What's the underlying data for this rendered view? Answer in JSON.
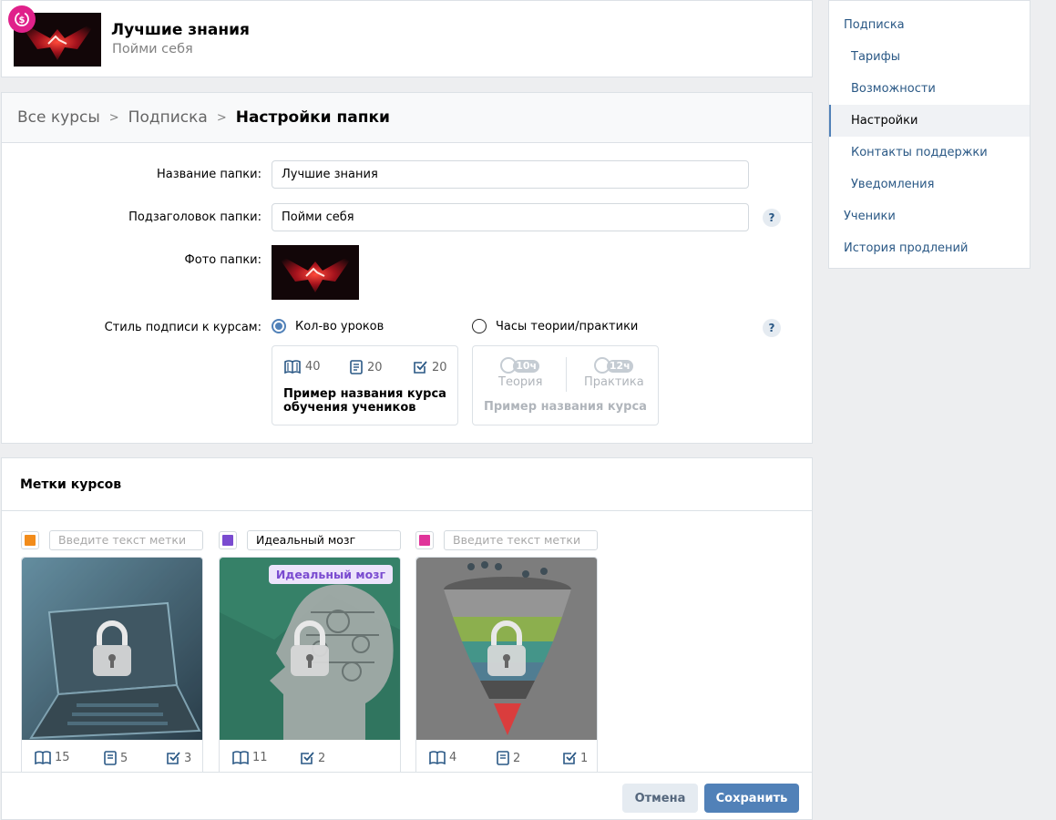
{
  "header": {
    "title": "Лучшие знания",
    "subtitle": "Пойми себя",
    "badge_icon": "subscription-dollar-icon"
  },
  "breadcrumb": {
    "items": [
      "Все курсы",
      "Подписка",
      "Настройки папки"
    ]
  },
  "form": {
    "folder_name_label": "Название папки:",
    "folder_name_value": "Лучшие знания",
    "folder_subtitle_label": "Подзаголовок папки:",
    "folder_subtitle_value": "Пойми себя",
    "folder_photo_label": "Фото папки:",
    "caption_style_label": "Стиль подписи к курсам:",
    "help_glyph": "?",
    "option_lessons": "Кол-во уроков",
    "option_hours": "Часы теории/практики",
    "selected_option": "lessons",
    "sample_lessons": {
      "lessons": "40",
      "tests": "20",
      "tasks": "20",
      "name": "Пример названия курса обучения учеников"
    },
    "sample_hours": {
      "theory_hours": "10ч",
      "theory_label": "Теория",
      "practice_hours": "12ч",
      "practice_label": "Практика",
      "name": "Пример названия курса"
    }
  },
  "tags": {
    "title": "Метки курсов",
    "items": [
      {
        "color": "#f28c1b",
        "placeholder": "Введите текст метки",
        "value": "",
        "lessons": "15",
        "tests": "5",
        "tasks": "3"
      },
      {
        "color": "#7a4bd0",
        "placeholder": "Введите текст метки",
        "value": "Идеальный мозг",
        "lessons": "11",
        "tests": "",
        "tasks": "2"
      },
      {
        "color": "#e0349a",
        "placeholder": "Введите текст метки",
        "value": "",
        "lessons": "4",
        "tests": "2",
        "tasks": "1"
      }
    ]
  },
  "buttons": {
    "cancel": "Отмена",
    "save": "Сохранить"
  },
  "sidebar": {
    "items": [
      {
        "label": "Подписка",
        "level": 0
      },
      {
        "label": "Тарифы",
        "level": 1
      },
      {
        "label": "Возможности",
        "level": 1
      },
      {
        "label": "Настройки",
        "level": 1,
        "active": true
      },
      {
        "label": "Контакты поддержки",
        "level": 1
      },
      {
        "label": "Уведомления",
        "level": 1
      },
      {
        "label": "Ученики",
        "level": 0
      },
      {
        "label": "История продлений",
        "level": 0
      }
    ]
  }
}
